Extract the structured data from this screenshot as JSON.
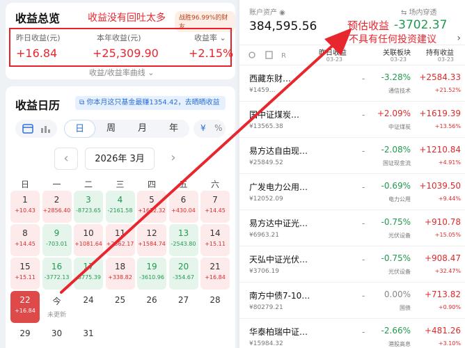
{
  "summary": {
    "title": "收益总览",
    "note": "收益没有回吐太多",
    "badge": "战胜96.99%的财友",
    "yesterday_label": "昨日收益(元)",
    "yesterday_value": "+16.84",
    "year_label": "本年收益(元)",
    "year_value": "+25,309.90",
    "rate_label": "收益率 ⌄",
    "rate_value": "+2.15%",
    "curve_link": "收益/收益率曲线 ⌄"
  },
  "calendar": {
    "title": "收益日历",
    "promo": "你本月这只基金最赚1354.42，去晒晒收益",
    "view_tabs": [
      "日",
      "周",
      "月",
      "年"
    ],
    "active_view": "日",
    "currency_yuan": "¥",
    "currency_pct": "%",
    "month": "2026年 3月",
    "prev": "‹",
    "next": "›",
    "weekdays": [
      "日",
      "一",
      "二",
      "三",
      "四",
      "五",
      "六"
    ],
    "days": [
      {
        "d": "1",
        "a": "+10.43",
        "t": "up"
      },
      {
        "d": "2",
        "a": "+2856.40",
        "t": "up"
      },
      {
        "d": "3",
        "a": "-8723.65",
        "t": "dn"
      },
      {
        "d": "4",
        "a": "-2161.58",
        "t": "dn"
      },
      {
        "d": "5",
        "a": "+1612.32",
        "t": "up"
      },
      {
        "d": "6",
        "a": "+430.04",
        "t": "up"
      },
      {
        "d": "7",
        "a": "+14.45",
        "t": "up"
      },
      {
        "d": "8",
        "a": "+14.45",
        "t": "up"
      },
      {
        "d": "9",
        "a": "-703.01",
        "t": "dn"
      },
      {
        "d": "10",
        "a": "+1081.64",
        "t": "up"
      },
      {
        "d": "11",
        "a": "+2362.17",
        "t": "up"
      },
      {
        "d": "12",
        "a": "+1584.74",
        "t": "up"
      },
      {
        "d": "13",
        "a": "-2543.80",
        "t": "dn"
      },
      {
        "d": "14",
        "a": "+15.11",
        "t": "up"
      },
      {
        "d": "15",
        "a": "+15.11",
        "t": "up"
      },
      {
        "d": "16",
        "a": "-3772.13",
        "t": "dn"
      },
      {
        "d": "17",
        "a": "-3775.39",
        "t": "dn"
      },
      {
        "d": "18",
        "a": "+338.82",
        "t": "up"
      },
      {
        "d": "19",
        "a": "-3610.96",
        "t": "dn"
      },
      {
        "d": "20",
        "a": "-354.67",
        "t": "dn"
      },
      {
        "d": "21",
        "a": "+16.84",
        "t": "up"
      },
      {
        "d": "22",
        "a": "+16.84",
        "t": "today"
      },
      {
        "d": "今",
        "a": "未更新",
        "t": "noupd"
      },
      {
        "d": "24",
        "a": "",
        "t": "plain"
      },
      {
        "d": "25",
        "a": "",
        "t": "plain"
      },
      {
        "d": "26",
        "a": "",
        "t": "plain"
      },
      {
        "d": "27",
        "a": "",
        "t": "plain"
      },
      {
        "d": "28",
        "a": "",
        "t": "plain"
      },
      {
        "d": "29",
        "a": "",
        "t": "plain"
      },
      {
        "d": "30",
        "a": "",
        "t": "plain"
      },
      {
        "d": "31",
        "a": "",
        "t": "plain"
      }
    ]
  },
  "account": {
    "label": "账户资产 ◉",
    "value": "384,595.56",
    "est_label": "预估收益",
    "est_value": "-3702.37",
    "warning": "不具有任何投资建议",
    "pass_link": "⇆ 场内穿透"
  },
  "table": {
    "col_yesterday": "昨日收益",
    "col_sector": "关联板块",
    "col_holding": "持有收益",
    "date1": "03-23",
    "date2": "03-23",
    "date3": "03-23",
    "next_icon": "›",
    "rows": [
      {
        "name": "西藏东财…",
        "amt": "¥1459…",
        "y": "-",
        "pct": "-3.28%",
        "pc": "green",
        "sec": "通信技术",
        "hold": "+2584.33",
        "hc": "red",
        "holdp": "+21.52%",
        "hpc": "red"
      },
      {
        "name": "国中证煤炭…",
        "amt": "¥13565.38",
        "y": "-",
        "pct": "+2.09%",
        "pc": "red",
        "sec": "中证煤炭",
        "hold": "+1619.39",
        "hc": "red",
        "holdp": "+13.56%",
        "hpc": "red"
      },
      {
        "name": "易方达自由现…",
        "amt": "¥25849.52",
        "y": "-",
        "pct": "-2.08%",
        "pc": "green",
        "sec": "国证现金流",
        "hold": "+1210.84",
        "hc": "red",
        "holdp": "+4.91%",
        "hpc": "red"
      },
      {
        "name": "广发电力公用…",
        "amt": "¥12052.09",
        "y": "-",
        "pct": "-0.69%",
        "pc": "green",
        "sec": "电力公用",
        "hold": "+1039.50",
        "hc": "red",
        "holdp": "+9.44%",
        "hpc": "red"
      },
      {
        "name": "易方达中证光…",
        "amt": "¥6963.21",
        "y": "-",
        "pct": "-0.75%",
        "pc": "green",
        "sec": "光伏设备",
        "hold": "+910.78",
        "hc": "red",
        "holdp": "+15.05%",
        "hpc": "red"
      },
      {
        "name": "天弘中证光伏…",
        "amt": "¥3706.19",
        "y": "-",
        "pct": "-0.75%",
        "pc": "green",
        "sec": "光伏设备",
        "hold": "+908.47",
        "hc": "red",
        "holdp": "+32.47%",
        "hpc": "red"
      },
      {
        "name": "南方中债7-10…",
        "amt": "¥80279.21",
        "y": "-",
        "pct": "0.00%",
        "pc": "grey",
        "sec": "国债",
        "hold": "+713.82",
        "hc": "red",
        "holdp": "+0.90%",
        "hpc": "red"
      },
      {
        "name": "华泰柏瑞中证…",
        "amt": "¥15984.32",
        "y": "-",
        "pct": "-2.66%",
        "pc": "green",
        "sec": "港股高息",
        "hold": "+481.26",
        "hc": "red",
        "holdp": "+3.10%",
        "hpc": "red"
      }
    ]
  },
  "colors": {
    "red": "#e02a2a",
    "green": "#1e9a4e",
    "accent": "#2b6fd6",
    "annotation": "#e8262e"
  }
}
